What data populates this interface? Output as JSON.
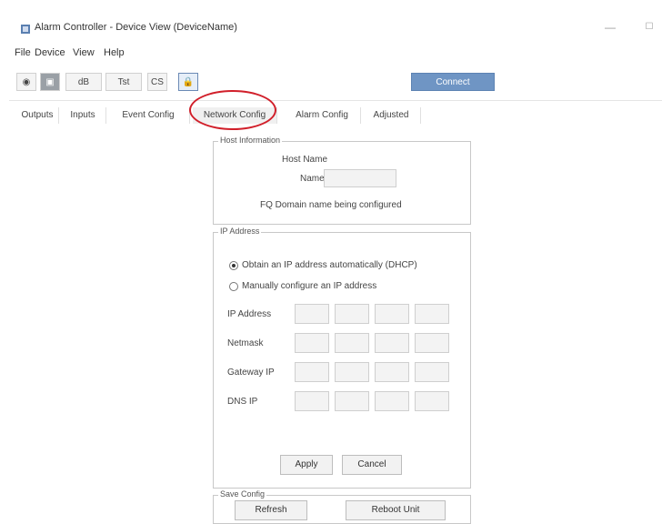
{
  "window": {
    "title": "Alarm Controller - Device View (DeviceName)",
    "minimize_glyph": "—",
    "maximize_glyph": "☐"
  },
  "menu": [
    "File",
    "Device",
    "View",
    "Help"
  ],
  "toolbar": {
    "buttons": [
      {
        "label": "◉",
        "icon": "record-icon"
      },
      {
        "label": "▣",
        "icon": "module-icon"
      },
      {
        "label": "dB",
        "icon": "db-icon"
      },
      {
        "label": "Tst",
        "icon": "test-icon"
      },
      {
        "label": "CS",
        "icon": "cs-icon"
      },
      {
        "label": "🔒",
        "icon": "lock-icon"
      }
    ],
    "connect_label": "Connect",
    "connect_color": "#6f95c4"
  },
  "tabs": [
    {
      "label": "Outputs"
    },
    {
      "label": "Inputs"
    },
    {
      "label": "Event Config"
    },
    {
      "label": "Network Config",
      "active": true
    },
    {
      "label": "Alarm Config"
    },
    {
      "label": "Adjusted"
    }
  ],
  "panel": {
    "host_group_label": "Host Information",
    "host_name_caption": "Host Name",
    "name_label": "Name",
    "name_value": "",
    "dns_text": "FQ Domain name being configured",
    "ip_group_label": "IP Address",
    "auto_radio_label": "Obtain an IP address automatically (DHCP)",
    "manual_radio_label": "Manually configure an IP address",
    "row_labels": [
      "IP Address",
      "Netmask",
      "Gateway IP",
      "DNS IP"
    ],
    "ok_label": "Apply",
    "cancel_label": "Cancel",
    "bottom_group_label": "Save Config",
    "refresh_label": "Refresh",
    "reboot_label": "Reboot Unit"
  },
  "colors": {
    "highlight": "#d11f2a"
  }
}
